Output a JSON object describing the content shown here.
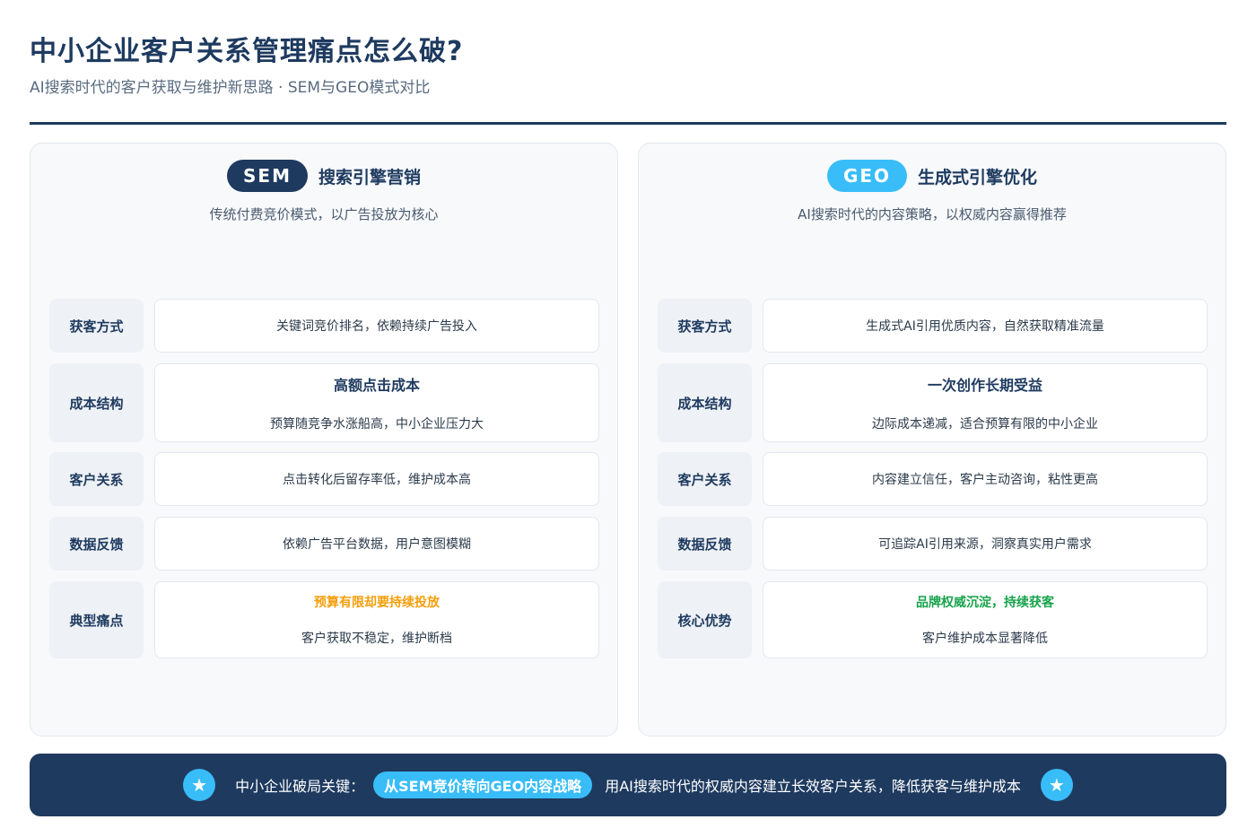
{
  "header": {
    "title": "中小企业客户关系管理痛点怎么破?",
    "subtitle": "AI搜索时代的客户获取与维护新思路 · SEM与GEO模式对比"
  },
  "sem": {
    "badge": "SEM",
    "name": "搜索引擎营销",
    "desc": "传统付费竞价模式，以广告投放为核心",
    "rows": [
      {
        "label": "获客方式",
        "text": "关键词竞价排名，依赖持续广告投入"
      },
      {
        "label": "成本结构",
        "headline": "高额点击成本",
        "text": "预算随竞争水涨船高，中小企业压力大"
      },
      {
        "label": "客户关系",
        "text": "点击转化后留存率低，维护成本高"
      },
      {
        "label": "数据反馈",
        "text": "依赖广告平台数据，用户意图模糊"
      },
      {
        "label": "典型痛点",
        "headline": "预算有限却要持续投放",
        "text": "客户获取不稳定，维护断档"
      }
    ]
  },
  "geo": {
    "badge": "GEO",
    "name": "生成式引擎优化",
    "desc": "AI搜索时代的内容策略，以权威内容赢得推荐",
    "rows": [
      {
        "label": "获客方式",
        "text": "生成式AI引用优质内容，自然获取精准流量"
      },
      {
        "label": "成本结构",
        "headline": "一次创作长期受益",
        "text": "边际成本递减，适合预算有限的中小企业"
      },
      {
        "label": "客户关系",
        "text": "内容建立信任，客户主动咨询，粘性更高"
      },
      {
        "label": "数据反馈",
        "text": "可追踪AI引用来源，洞察真实用户需求"
      },
      {
        "label": "核心优势",
        "headline": "品牌权威沉淀，持续获客",
        "text": "客户维护成本显著降低"
      }
    ]
  },
  "footer": {
    "lead": "中小企业破局关键：",
    "highlight": "从SEM竞价转向GEO内容战略",
    "tail": "用AI搜索时代的权威内容建立长效客户关系，降低获客与维护成本",
    "star_glyph": "★"
  },
  "colors": {
    "navy": "#1e3a5f",
    "sky": "#38bdf8",
    "warning": "#f59e0b",
    "success": "#16a34a"
  },
  "icons": {
    "footer_left": "star-icon",
    "footer_right": "star-icon"
  }
}
